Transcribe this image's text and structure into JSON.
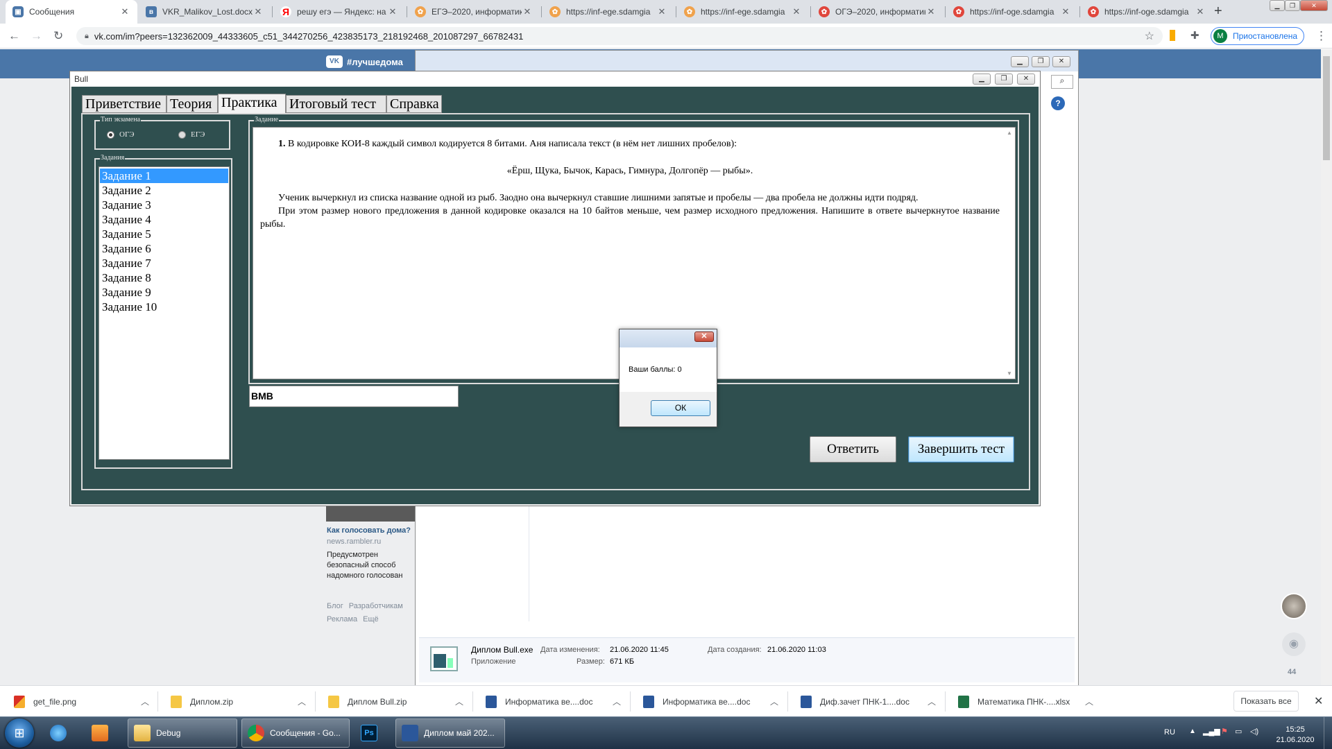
{
  "browser": {
    "tabs": [
      {
        "label": "Сообщения",
        "favicon": "vk-messages-icon",
        "active": true
      },
      {
        "label": "VKR_Malikov_Lost.docx",
        "favicon": "vk-icon"
      },
      {
        "label": "решу егэ — Яндекс: на",
        "favicon": "yandex-icon"
      },
      {
        "label": "ЕГЭ–2020, информатик",
        "favicon": "sdamgia-icon"
      },
      {
        "label": "https://inf-ege.sdamgia",
        "favicon": "sdamgia-icon"
      },
      {
        "label": "https://inf-ege.sdamgia",
        "favicon": "sdamgia-icon"
      },
      {
        "label": "ОГЭ–2020, информатик",
        "favicon": "sdamgia-red-icon"
      },
      {
        "label": "https://inf-oge.sdamgia",
        "favicon": "sdamgia-red-icon"
      },
      {
        "label": "https://inf-oge.sdamgia",
        "favicon": "sdamgia-red-icon"
      }
    ],
    "url": "vk.com/im?peers=132362009_44333605_c51_344270256_423835173_218192468_201087297_66782431",
    "profile": {
      "initial": "M",
      "label": "Приостановлена"
    }
  },
  "vk": {
    "header_tag": "#лучшедома",
    "ad": {
      "title": "Как голосовать дома?",
      "source": "news.rambler.ru",
      "text": "Предусмотрен безопасный способ надомного голосован"
    },
    "footer_links": [
      "Блог",
      "Разработчикам",
      "Реклама",
      "Ещё"
    ],
    "unread_count": "44"
  },
  "explorer": {
    "file_name": "Диплом Bull.exe",
    "file_type": "Приложение",
    "modified_label": "Дата изменения:",
    "modified_value": "21.06.2020 11:45",
    "created_label": "Дата создания:",
    "created_value": "21.06.2020 11:03",
    "size_label": "Размер:",
    "size_value": "671 КБ"
  },
  "app": {
    "title": "Bull",
    "tabs": [
      "Приветствие",
      "Теория",
      "Практика",
      "Итоговый тест",
      "Справка"
    ],
    "selected_tab": "Практика",
    "exam_type": {
      "label": "Тип экзамена",
      "options": [
        "ОГЭ",
        "ЕГЭ"
      ],
      "selected": "ОГЭ"
    },
    "tasks_group_label": "Задания",
    "tasks": [
      "Задание 1",
      "Задание 2",
      "Задание 3",
      "Задание 4",
      "Задание 5",
      "Задание 6",
      "Задание 7",
      "Задание 8",
      "Задание 9",
      "Задание 10"
    ],
    "selected_task": "Задание 1",
    "task_group_label": "Задание",
    "task": {
      "number": "1.",
      "line1": "В кодировке КОИ-8 каждый символ кодируется 8 битами. Аня написала текст (в нём нет лишних пробелов):",
      "quote": "«Ёрш, Щука, Бычок, Карась, Гимнура, Долгопёр — рыбы».",
      "para2": "Ученик вычеркнул из списка название одной из рыб. Заодно она вычеркнул ставшие лишними запятые и пробелы — два пробела не должны идти подряд.",
      "para3": "При этом размер нового предложения в данной кодировке оказался на 10 байтов меньше, чем размер исходного предложения. Напишите в ответе вычеркнутое название рыбы."
    },
    "answer_value": "ВМВ",
    "answer_button": "Ответить",
    "finish_button": "Завершить тест"
  },
  "dialog": {
    "message": "Ваши баллы: 0",
    "ok_label": "ОК"
  },
  "downloads": {
    "items": [
      "get_file.png",
      "Диплом.zip",
      "Диплом Bull.zip",
      "Информатика ве....doc",
      "Информатика ве....doc",
      "Диф.зачет ПНК-1....doc",
      "Математика ПНК-....xlsx"
    ],
    "show_all": "Показать все"
  },
  "taskbar": {
    "apps": [
      {
        "label": "Debug",
        "icon": "folder-icon"
      },
      {
        "label": "Сообщения - Go...",
        "icon": "chrome-icon"
      },
      {
        "label": "Диплом май 202...",
        "icon": "word-icon"
      }
    ],
    "language": "RU",
    "time": "15:25",
    "date": "21.06.2020"
  },
  "colors": {
    "app_background": "#2f4f4f",
    "selection": "#3399ff",
    "vk_header": "#4a76a8"
  }
}
